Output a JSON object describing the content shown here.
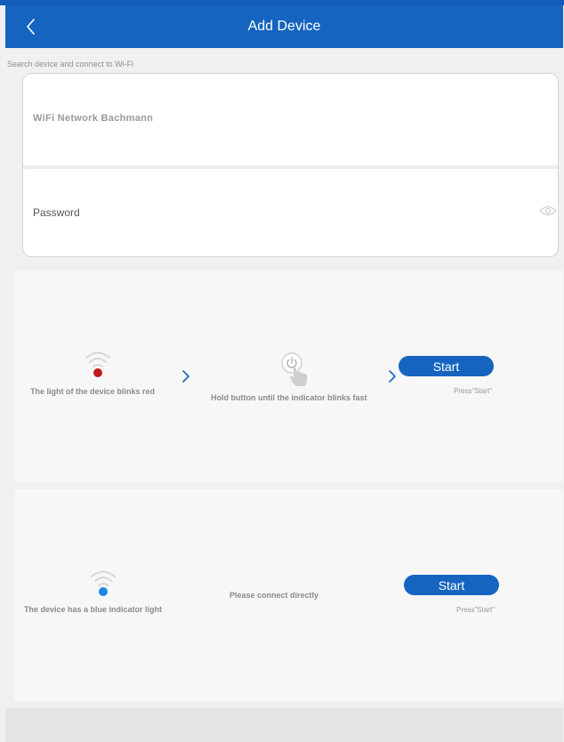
{
  "header": {
    "title": "Add Device",
    "back_icon": "chevron-left-icon"
  },
  "hint": "Search device and connect to Wi-Fi",
  "form": {
    "wifi_name": "WiFi Network Bachmann",
    "password_placeholder": "Password",
    "password_value": "",
    "eye_icon": "eye-icon"
  },
  "panel1": {
    "step1_label": "The light of the device blinks red",
    "step2_label": "Hold button until the indicator blinks fast",
    "start_label": "Start",
    "press_hint": "Press\"Start\"",
    "colors": {
      "indicator": "#c21a1a"
    }
  },
  "panel2": {
    "step1_label": "The device has a blue indicator light",
    "step2_label": "Please connect directly",
    "start_label": "Start",
    "press_hint": "Press\"Start\"",
    "colors": {
      "indicator": "#1e88e5"
    }
  },
  "colors": {
    "accent": "#1565c0",
    "background": "#f0f0f0"
  }
}
